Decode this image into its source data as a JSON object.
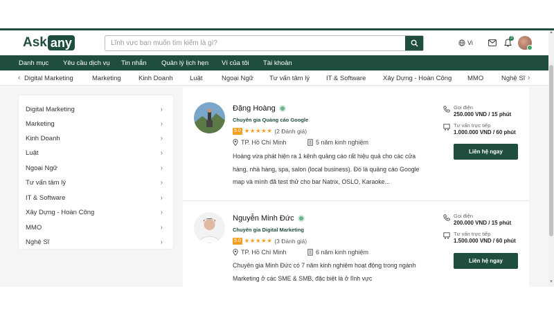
{
  "header": {
    "logo_text": "Ask",
    "logo_box": "any",
    "search_placeholder": "Lĩnh vực bạn muốn tìm kiếm là gì?",
    "lang": "Vi",
    "notification_count": "3"
  },
  "mainnav": [
    "Danh mục",
    "Yêu cầu dịch vụ",
    "Tin nhắn",
    "Quản lý lịch hẹn",
    "Ví của tôi",
    "Tài khoản"
  ],
  "categories": [
    "Digital Marketing",
    "Marketing",
    "Kinh Doanh",
    "Luật",
    "Ngoại Ngữ",
    "Tư vấn tâm lý",
    "IT & Software",
    "Xây Dựng - Hoàn Công",
    "MMO",
    "Nghệ Sĩ"
  ],
  "sidebar": [
    "Digital Marketing",
    "Marketing",
    "Kinh Doanh",
    "Luật",
    "Ngoại Ngữ",
    "Tư vấn tâm lý",
    "IT & Software",
    "Xây Dựng - Hoàn Công",
    "MMO",
    "Nghệ Sĩ"
  ],
  "experts": [
    {
      "name": "Đặng Hoàng",
      "title": "Chuyên gia Quảng cáo Google",
      "rating": "5.0",
      "stars": "★★★★★",
      "reviews": "(2 Đánh giá)",
      "location": "TP. Hồ Chí Minh",
      "experience": "5 năm kinh nghiệm",
      "desc": "Hoàng vừa phát hiện ra 1 kênh quảng cáo rất hiệu quả cho các cửa hàng, nhà hàng, spa, salon (local business). Đó là quảng cáo Google map và mình đã test thử cho bar Natrix, OSLO, Karaoke...",
      "call_label": "Gọi điện",
      "call_price": "250.000 VND / 15 phút",
      "direct_label": "Tư vấn trực tiếp",
      "direct_price": "1.000.000 VND / 60 phút",
      "contact": "Liên hệ ngay"
    },
    {
      "name": "Nguyễn Minh Đức",
      "title": "Chuyên gia Digital Marketing",
      "rating": "5.0",
      "stars": "★★★★★",
      "reviews": "(3 Đánh giá)",
      "location": "TP. Hồ Chí Minh",
      "experience": "6 năm kinh nghiệm",
      "desc": "Chuyên gia Minh Đức có 7 năm kinh nghiệm hoạt động trong ngành Marketing ở các SME & SMB, đặc biệt là ở lĩnh vực",
      "call_label": "Gọi điện",
      "call_price": "200.000 VND / 15 phút",
      "direct_label": "Tư vấn trực tiếp",
      "direct_price": "1.500.000 VND / 60 phút",
      "contact": "Liên hệ ngay"
    }
  ],
  "colors": {
    "brand": "#1f4d3f",
    "star": "#f0a020"
  }
}
